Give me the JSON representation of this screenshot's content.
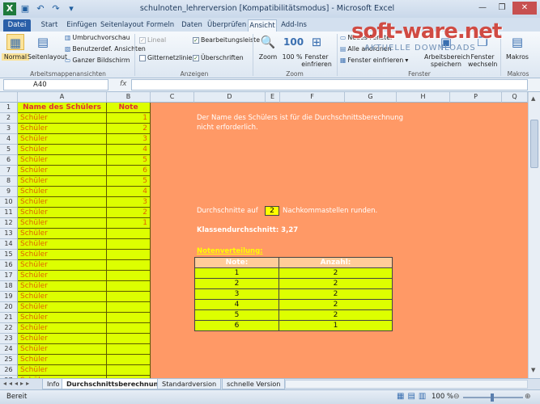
{
  "window": {
    "title": "schulnoten_lehrerversion  [Kompatibilitätsmodus]  -  Microsoft Excel"
  },
  "tabs": [
    "Datei",
    "Start",
    "Einfügen",
    "Seitenlayout",
    "Formeln",
    "Daten",
    "Überprüfen",
    "Ansicht",
    "Add-Ins"
  ],
  "ribbon": {
    "arbeitsmappe": {
      "label": "Arbeitsmappenansichten",
      "normal": "Normal",
      "seitenlayout": "Seitenlayout",
      "umbruch": "Umbruchvorschau",
      "benutzer": "Benutzerdef. Ansichten",
      "ganzer": "Ganzer Bildschirm"
    },
    "anzeigen": {
      "label": "Anzeigen",
      "lineal": "Lineal",
      "bearbeitungsleiste": "Bearbeitungsleiste",
      "gitternetz": "Gitternetzlinien",
      "ueberschriften": "Überschriften"
    },
    "zoom": {
      "label": "Zoom",
      "zoom": "Zoom",
      "hundert": "100 %",
      "auswahl": "Fenster einfrieren"
    },
    "fenster": {
      "label": "Fenster",
      "neues": "Neues Fenster",
      "alle": "Alle anordnen",
      "einfrieren": "Fenster einfrieren",
      "speichern": "Arbeitsbereich speichern",
      "wechseln": "Fenster wechseln"
    },
    "makros": {
      "label": "Makros",
      "makros": "Makros"
    }
  },
  "logo": {
    "main": "soft-ware.net",
    "sub": "AKTUELLE DOWNLOADS"
  },
  "formula": {
    "namebox": "A40",
    "fx": "fx"
  },
  "columns": [
    "A",
    "B",
    "C",
    "D",
    "E",
    "F",
    "G",
    "H",
    "P",
    "Q"
  ],
  "grid": {
    "header_a": "Name des Schülers",
    "header_b": "Note",
    "rows": [
      {
        "n": "1"
      },
      {
        "n": "2",
        "a": "Schüler",
        "b": "1"
      },
      {
        "n": "3",
        "a": "Schüler",
        "b": "2"
      },
      {
        "n": "4",
        "a": "Schüler",
        "b": "3"
      },
      {
        "n": "5",
        "a": "Schüler",
        "b": "4"
      },
      {
        "n": "6",
        "a": "Schüler",
        "b": "5"
      },
      {
        "n": "7",
        "a": "Schüler",
        "b": "6"
      },
      {
        "n": "8",
        "a": "Schüler",
        "b": "5"
      },
      {
        "n": "9",
        "a": "Schüler",
        "b": "4"
      },
      {
        "n": "10",
        "a": "Schüler",
        "b": "3"
      },
      {
        "n": "11",
        "a": "Schüler",
        "b": "2"
      },
      {
        "n": "12",
        "a": "Schüler",
        "b": "1"
      },
      {
        "n": "13",
        "a": "Schüler",
        "b": ""
      },
      {
        "n": "14",
        "a": "Schüler",
        "b": ""
      },
      {
        "n": "15",
        "a": "Schüler",
        "b": ""
      },
      {
        "n": "16",
        "a": "Schüler",
        "b": ""
      },
      {
        "n": "17",
        "a": "Schüler",
        "b": ""
      },
      {
        "n": "18",
        "a": "Schüler",
        "b": ""
      },
      {
        "n": "19",
        "a": "Schüler",
        "b": ""
      },
      {
        "n": "20",
        "a": "Schüler",
        "b": ""
      },
      {
        "n": "21",
        "a": "Schüler",
        "b": ""
      },
      {
        "n": "22",
        "a": "Schüler",
        "b": ""
      },
      {
        "n": "23",
        "a": "Schüler",
        "b": ""
      },
      {
        "n": "24",
        "a": "Schüler",
        "b": ""
      },
      {
        "n": "25",
        "a": "Schüler",
        "b": ""
      },
      {
        "n": "26",
        "a": "Schüler",
        "b": ""
      },
      {
        "n": "27",
        "a": "Schüler",
        "b": ""
      }
    ]
  },
  "sheet": {
    "info_line1": "Der Name des Schülers ist für die Durchschnittsberechnung",
    "info_line2": "nicht erforderlich.",
    "round_prefix": "Durchschnitte auf",
    "round_value": "2",
    "round_suffix": "Nachkommastellen runden.",
    "average": "Klassendurchschnitt: 3,27",
    "dist_title": "Notenverteilung:",
    "dist_header_note": "Note:",
    "dist_header_count": "Anzahl:",
    "dist_rows": [
      {
        "note": "1",
        "count": "2"
      },
      {
        "note": "2",
        "count": "2"
      },
      {
        "note": "3",
        "count": "2"
      },
      {
        "note": "4",
        "count": "2"
      },
      {
        "note": "5",
        "count": "2"
      },
      {
        "note": "6",
        "count": "1"
      }
    ]
  },
  "sheet_tabs": [
    "Info",
    "Durchschnittsberechnung",
    "Standardversion",
    "schnelle Version"
  ],
  "status": {
    "ready": "Bereit",
    "zoom": "100 %"
  }
}
